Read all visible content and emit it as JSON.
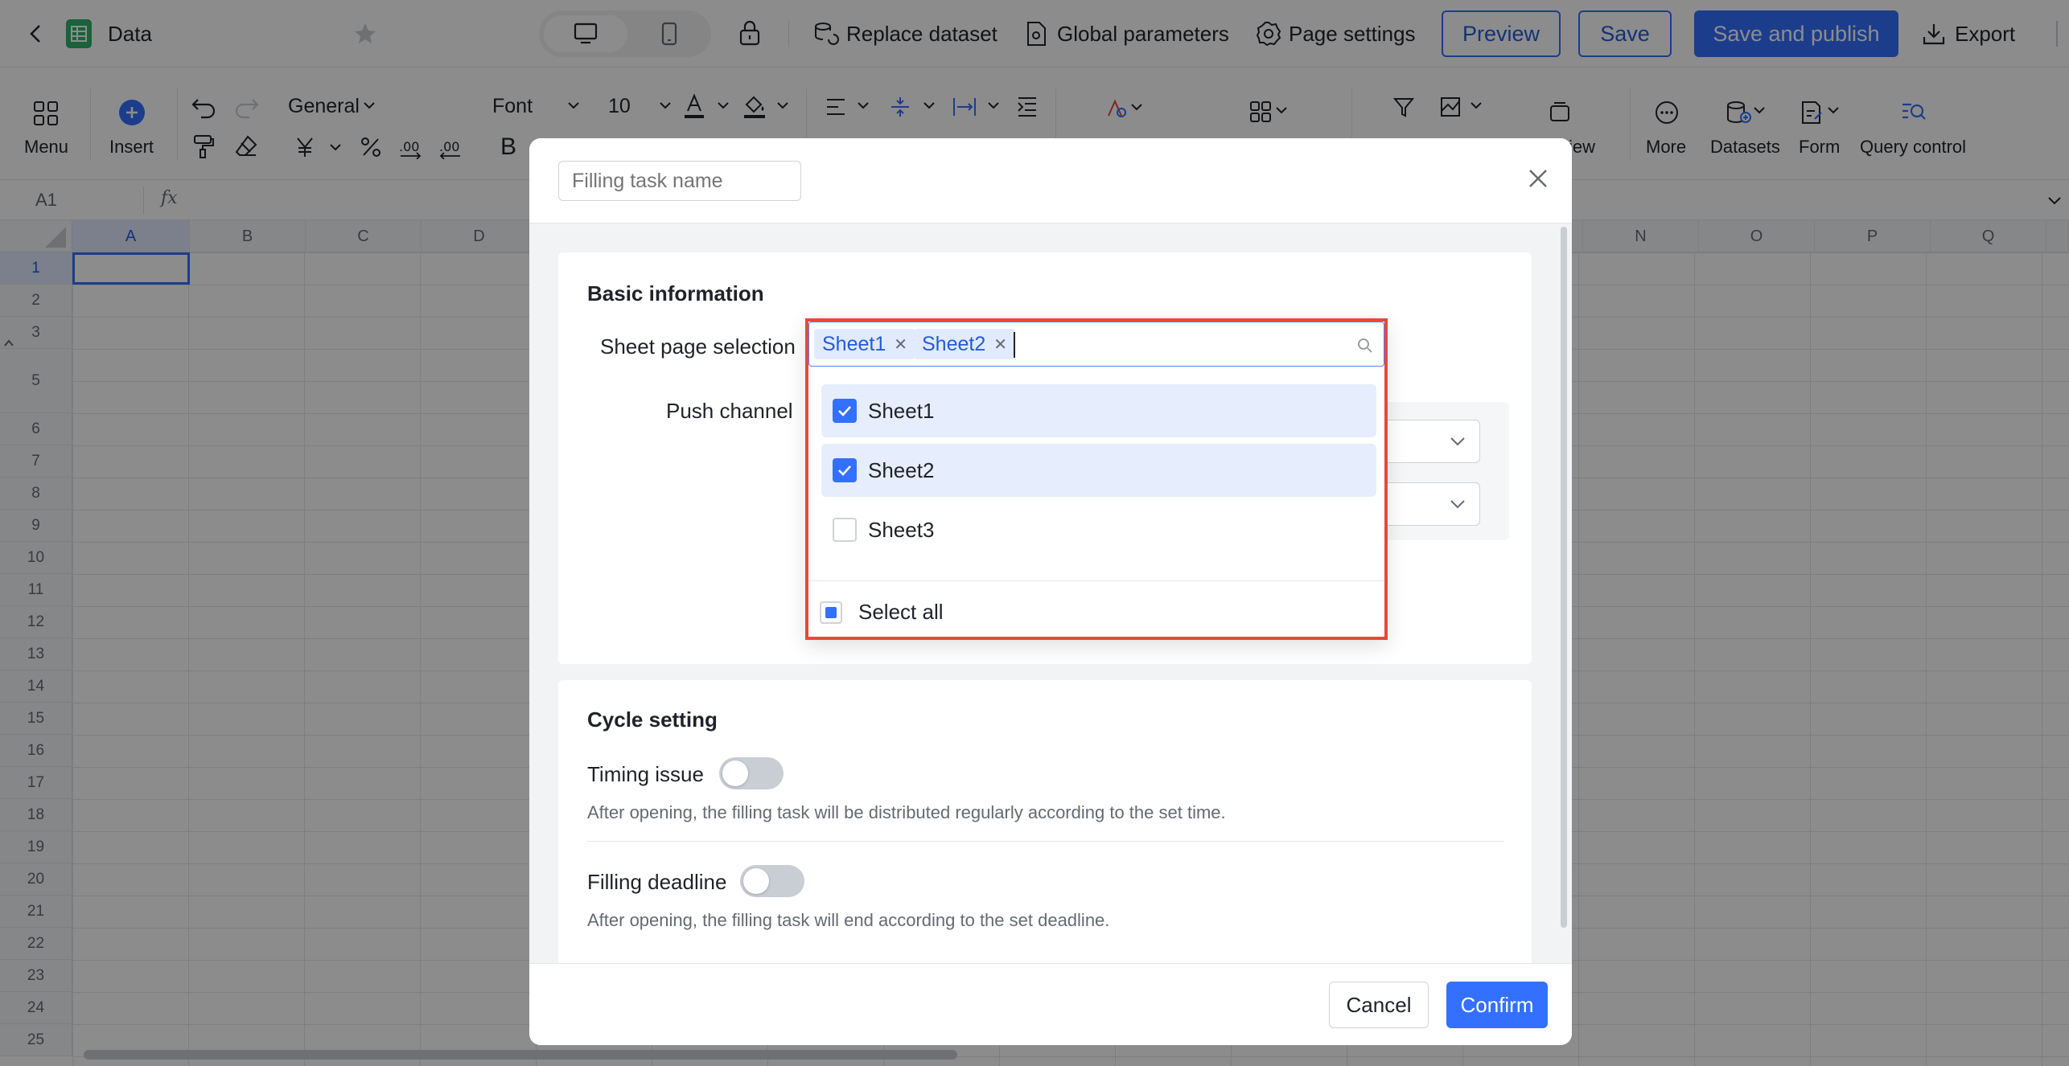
{
  "app": {
    "title": "Data"
  },
  "topbar": {
    "replace_dataset": "Replace dataset",
    "global_parameters": "Global parameters",
    "page_settings": "Page settings",
    "preview": "Preview",
    "save": "Save",
    "save_publish": "Save and publish",
    "export": "Export"
  },
  "toolbar": {
    "menu": "Menu",
    "insert": "Insert",
    "number_format": "General",
    "font": "Font",
    "font_size": "10",
    "bold": "B",
    "more": "More",
    "datasets": "Datasets",
    "form": "Form",
    "query_control": "Query control",
    "view_partial": "iew"
  },
  "formula": {
    "cell_ref": "A1",
    "fx": "fx"
  },
  "grid": {
    "columns_left": [
      "A",
      "B",
      "C",
      "D"
    ],
    "columns_right": [
      "N",
      "O",
      "P",
      "Q"
    ],
    "rows": [
      "1",
      "2",
      "3",
      "5",
      "6",
      "7",
      "8",
      "9",
      "10",
      "11",
      "12",
      "13",
      "14",
      "15",
      "16",
      "17",
      "18",
      "19",
      "20",
      "21",
      "22",
      "23",
      "24",
      "25"
    ]
  },
  "modal": {
    "task_name_placeholder": "Filling task name",
    "basic_info_title": "Basic information",
    "sheet_selection_label": "Sheet page selection",
    "push_channel_label": "Push channel",
    "cycle_title": "Cycle setting",
    "timing_label": "Timing issue",
    "timing_desc": "After opening, the filling task will be distributed regularly according to the set time.",
    "deadline_label": "Filling deadline",
    "deadline_desc": "After opening, the filling task will end according to the set deadline.",
    "cancel": "Cancel",
    "confirm": "Confirm"
  },
  "dropdown": {
    "selected_tags": [
      "Sheet1",
      "Sheet2"
    ],
    "options": [
      {
        "label": "Sheet1",
        "checked": true
      },
      {
        "label": "Sheet2",
        "checked": true
      },
      {
        "label": "Sheet3",
        "checked": false
      }
    ],
    "select_all": "Select all"
  },
  "colors": {
    "primary": "#3370ff",
    "highlight_border": "#e8483b",
    "tag_bg": "#e1eaff",
    "option_selected_bg": "#e6edfc"
  }
}
